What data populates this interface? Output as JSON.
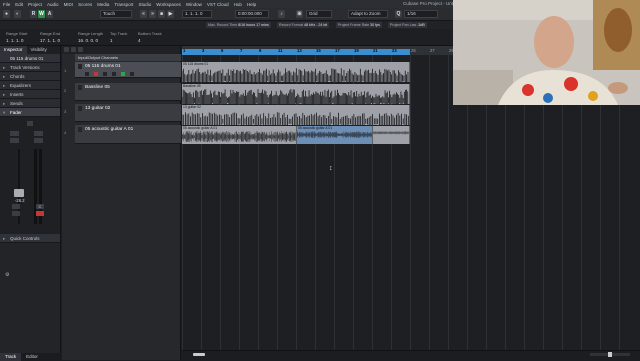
{
  "menu": [
    "File",
    "Edit",
    "Project",
    "Audio",
    "MIDI",
    "Scores",
    "Media",
    "Transport",
    "Studio",
    "Workspaces",
    "Window",
    "VST Cloud",
    "Hub",
    "Help"
  ],
  "window_title": "Cubase Pro Project - Untitled1",
  "toolbar": {
    "buttons": [
      "R",
      "W",
      "A"
    ],
    "touch_mode": "Touch",
    "position": "1. 1. 1. 0",
    "time": "0:00:00.000",
    "grid_type": "Grid",
    "snap_mode": "Adapt to Zoom",
    "quantize": "1/16"
  },
  "info_line": [
    {
      "label": "Max. Record Time",
      "value": "8/16 hours 17 mins"
    },
    {
      "label": "Record Format",
      "value": "48 kHz - 24 bit"
    },
    {
      "label": "Project Frame Rate",
      "value": "30 fps"
    },
    {
      "label": "Project Pan Law",
      "value": "-3dB"
    }
  ],
  "range": [
    {
      "label": "Range Start",
      "value": "1. 1. 1. 0"
    },
    {
      "label": "Range End",
      "value": "17. 1. 1. 0"
    },
    {
      "label": "Range Length",
      "value": "16. 0. 0. 0"
    },
    {
      "label": "Top Track",
      "value": "1"
    },
    {
      "label": "Bottom Track",
      "value": "4"
    }
  ],
  "inspector": {
    "tabs": [
      "Inspector",
      "Visibility"
    ],
    "selected_track": "05 115 drums 01",
    "sections": [
      "Track Versions",
      "Chords",
      "Equalizers",
      "Inserts",
      "Sends",
      "Fader"
    ],
    "volume_readout": "-26.2",
    "pan_readout": "C",
    "quick_controls": "Quick Controls",
    "bottom_tabs": [
      "Track",
      "Editor"
    ]
  },
  "tracklist": {
    "folder": "Input/Output Channels",
    "tracks": [
      {
        "num": "1",
        "name": "05 115 drums 01",
        "selected": true
      },
      {
        "num": "2",
        "name": "Bassline 05",
        "selected": false
      },
      {
        "num": "3",
        "name": "13 guitar 02",
        "selected": false
      },
      {
        "num": "4",
        "name": "05 acoustic guitar A 01",
        "selected": false
      }
    ]
  },
  "ruler": [
    "1",
    "3",
    "5",
    "7",
    "9",
    "11",
    "13",
    "15",
    "17",
    "19",
    "21",
    "23",
    "25",
    "27",
    "29",
    "31",
    "33",
    "35",
    "37",
    "39",
    "41",
    "43",
    "45",
    "47"
  ],
  "clips": {
    "drums": "05 115 drums 01",
    "bass": "Bassline 05",
    "guitar": "13 guitar 02",
    "acoustic": "05 acoustic guitar A 01"
  },
  "colors": {
    "accent": "#3a8ecf",
    "clip": "#9ea2a8",
    "selected_clip": "#6d8fb5",
    "record": "#c93434",
    "active": "#2fa44f"
  }
}
